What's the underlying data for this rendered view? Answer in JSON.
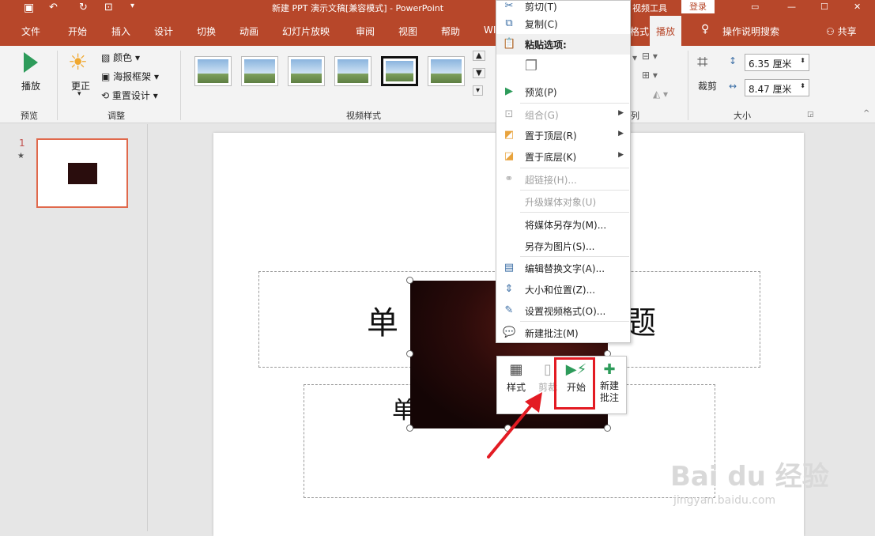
{
  "titlebar": {
    "doc_title": "新建 PPT 演示文稿[兼容模式]  -  PowerPoint",
    "context_tool": "视频工具",
    "login": "登录",
    "colors": {
      "brand": "#b7472a",
      "login_bg": "#ffffff"
    }
  },
  "tabs": [
    "文件",
    "开始",
    "插入",
    "设计",
    "切换",
    "动画",
    "幻灯片放映",
    "审阅",
    "视图",
    "帮助",
    "WI",
    "格式",
    "播放"
  ],
  "tell_me": "操作说明搜索",
  "share": "共享",
  "ribbon": {
    "preview": {
      "play": "播放",
      "group": "预览"
    },
    "adjust": {
      "correct": "更正",
      "color": "颜色",
      "poster": "海报框架",
      "reset": "重置设计",
      "group": "调整"
    },
    "video_styles_group": "视频样式",
    "arrange_group_tail": "列",
    "size": {
      "crop": "裁剪",
      "height": "6.35 厘米",
      "width": "8.47 厘米",
      "group": "大小"
    }
  },
  "slide_panel": {
    "number": "1",
    "star": "★"
  },
  "slide": {
    "title_partial_left": "单",
    "title_partial_right": "题",
    "subtitle_partial": "单"
  },
  "context_menu": {
    "items": [
      {
        "label": "剪切(T)",
        "icon": "scissors-icon",
        "disabled": false
      },
      {
        "label": "复制(C)",
        "icon": "copy-icon",
        "disabled": false
      },
      {
        "label": "粘贴选项:",
        "icon": "paste-icon",
        "disabled": false,
        "header": true
      },
      {
        "label": "预览(P)",
        "icon": "play-icon",
        "disabled": false
      },
      {
        "label": "组合(G)",
        "icon": "group-icon",
        "disabled": true,
        "submenu": true
      },
      {
        "label": "置于顶层(R)",
        "icon": "bring-front-icon",
        "disabled": false,
        "submenu": true
      },
      {
        "label": "置于底层(K)",
        "icon": "send-back-icon",
        "disabled": false,
        "submenu": true
      },
      {
        "label": "超链接(H)...",
        "icon": "link-icon",
        "disabled": true
      },
      {
        "label": "升级媒体对象(U)",
        "icon": "",
        "disabled": true
      },
      {
        "label": "将媒体另存为(M)...",
        "icon": "",
        "disabled": false
      },
      {
        "label": "另存为图片(S)...",
        "icon": "",
        "disabled": false
      },
      {
        "label": "编辑替换文字(A)...",
        "icon": "alt-text-icon",
        "disabled": false
      },
      {
        "label": "大小和位置(Z)...",
        "icon": "size-icon",
        "disabled": false
      },
      {
        "label": "设置视频格式(O)...",
        "icon": "format-icon",
        "disabled": false
      },
      {
        "label": "新建批注(M)",
        "icon": "comment-icon",
        "disabled": false
      }
    ]
  },
  "mini_toolbar": {
    "style": "样式",
    "trim": "剪裁",
    "start": "开始",
    "new_comment_1": "新建",
    "new_comment_2": "批注"
  },
  "watermark": {
    "main": "Bai du 经验",
    "url": "jingyan.baidu.com"
  }
}
